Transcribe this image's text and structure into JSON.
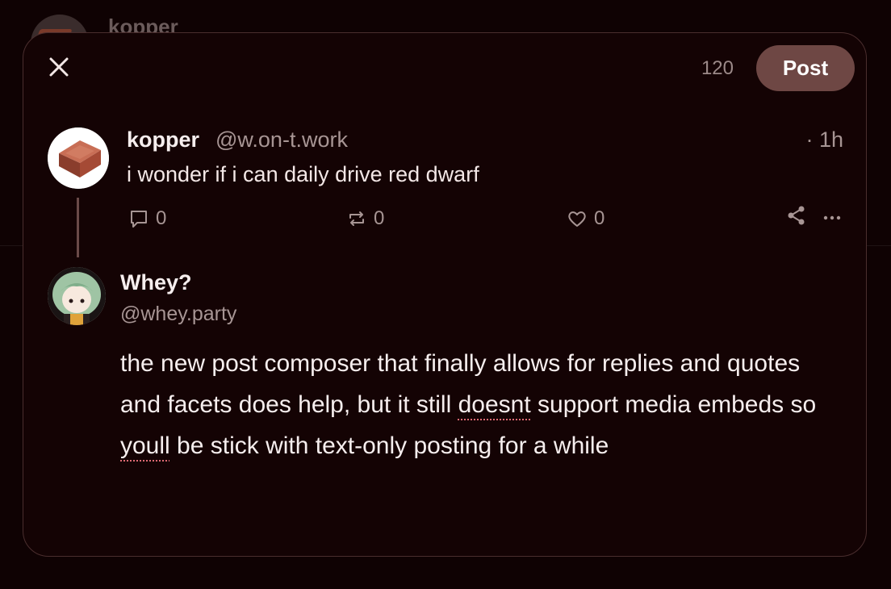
{
  "background": {
    "author_name": "kopper"
  },
  "composer": {
    "char_count": "120",
    "post_label": "Post"
  },
  "parent_post": {
    "author_name": "kopper",
    "author_handle": "@w.on-t.work",
    "time": "· 1h",
    "text": "i wonder if i can daily drive red dwarf",
    "reply_count": "0",
    "repost_count": "0",
    "like_count": "0"
  },
  "reply": {
    "author_name": "Whey?",
    "author_handle": "@whey.party",
    "text_segments": [
      "the new post composer that finally allows for replies and quotes and facets does help, but it still ",
      "doesnt",
      " support media embeds so ",
      "youll",
      " be stick with text-only posting for a while"
    ]
  },
  "colors": {
    "background": "#0f0203",
    "modal": "#140304",
    "post_button": "#6e4744",
    "muted_text": "#a79594",
    "spell_underline": "#e06a73"
  }
}
